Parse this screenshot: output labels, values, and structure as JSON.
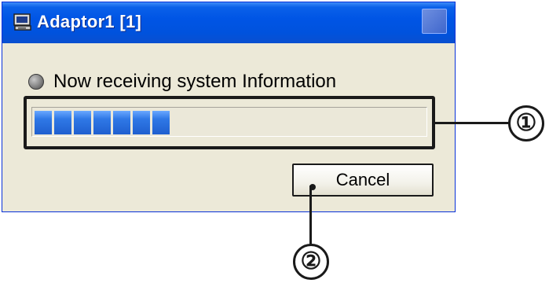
{
  "window": {
    "title": "Adaptor1 [1]"
  },
  "status": {
    "text": "Now receiving system Information",
    "icon": "status-led-gray"
  },
  "progress": {
    "filled_blocks": 7,
    "fraction": 0.33,
    "fill_color": "#2f78e6"
  },
  "buttons": {
    "cancel_label": "Cancel"
  },
  "callouts": {
    "one": "①",
    "two": "②"
  },
  "colors": {
    "titlebar": "#0055e5",
    "window_bg": "#ece9d8"
  }
}
